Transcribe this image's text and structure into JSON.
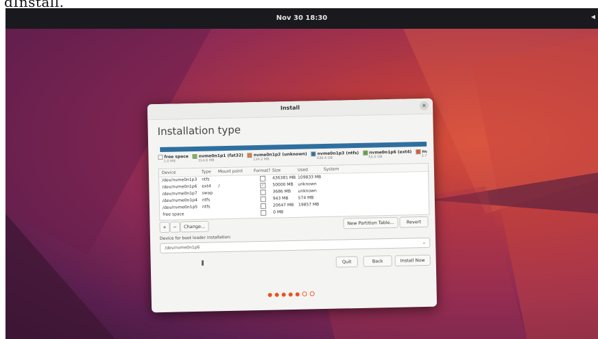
{
  "above_text": "dInstall.",
  "topbar": {
    "clock": "Nov 30 18:30"
  },
  "dialog": {
    "title": "Install",
    "heading": "Installation type",
    "legend": [
      {
        "name": "free space",
        "size": "1.0 MB",
        "color": "#ffffff"
      },
      {
        "name": "nvme0n1p1 (fat32)",
        "size": "314.6 MB",
        "color": "#7ab648"
      },
      {
        "name": "nvme0n1p2 (unknown)",
        "size": "134.2 MB",
        "color": "#e07b39"
      },
      {
        "name": "nvme0n1p3 (ntfs)",
        "size": "436.4 GB",
        "color": "#2f6f9f"
      },
      {
        "name": "nvme0n1p6 (ext4)",
        "size": "50.0 GB",
        "color": "#5aa832"
      },
      {
        "name": "nvm",
        "size": "3.7 G",
        "color": "#e0582b"
      }
    ],
    "table": {
      "headers": [
        "Device",
        "Type",
        "Mount point",
        "Format?",
        "Size",
        "Used",
        "System"
      ],
      "rows": [
        {
          "device": "/dev/nvme0n1p3",
          "type": "ntfs",
          "mount": "",
          "format": false,
          "size": "436381 MB",
          "used": "109833 MB"
        },
        {
          "device": "/dev/nvme0n1p6",
          "type": "ext4",
          "mount": "/",
          "format": true,
          "size": "50000 MB",
          "used": "unknown"
        },
        {
          "device": "/dev/nvme0n1p7",
          "type": "swap",
          "mount": "",
          "format": false,
          "size": "3686 MB",
          "used": "unknown"
        },
        {
          "device": "/dev/nvme0n1p4",
          "type": "ntfs",
          "mount": "",
          "format": false,
          "size": "943 MB",
          "used": "574 MB"
        },
        {
          "device": "/dev/nvme0n1p5",
          "type": "ntfs",
          "mount": "",
          "format": false,
          "size": "20647 MB",
          "used": "19857 MB"
        },
        {
          "device": "free space",
          "type": "",
          "mount": "",
          "format": false,
          "size": "0 MB",
          "used": ""
        }
      ]
    },
    "buttons": {
      "add": "+",
      "remove": "−",
      "change": "Change...",
      "new_table": "New Partition Table...",
      "revert": "Revert",
      "quit": "Quit",
      "back": "Back",
      "install": "Install Now"
    },
    "bootloader_label": "Device for boot loader installation:",
    "bootloader_value": "/dev/nvme0n1p6",
    "progress": {
      "total": 7,
      "done": 5
    }
  }
}
